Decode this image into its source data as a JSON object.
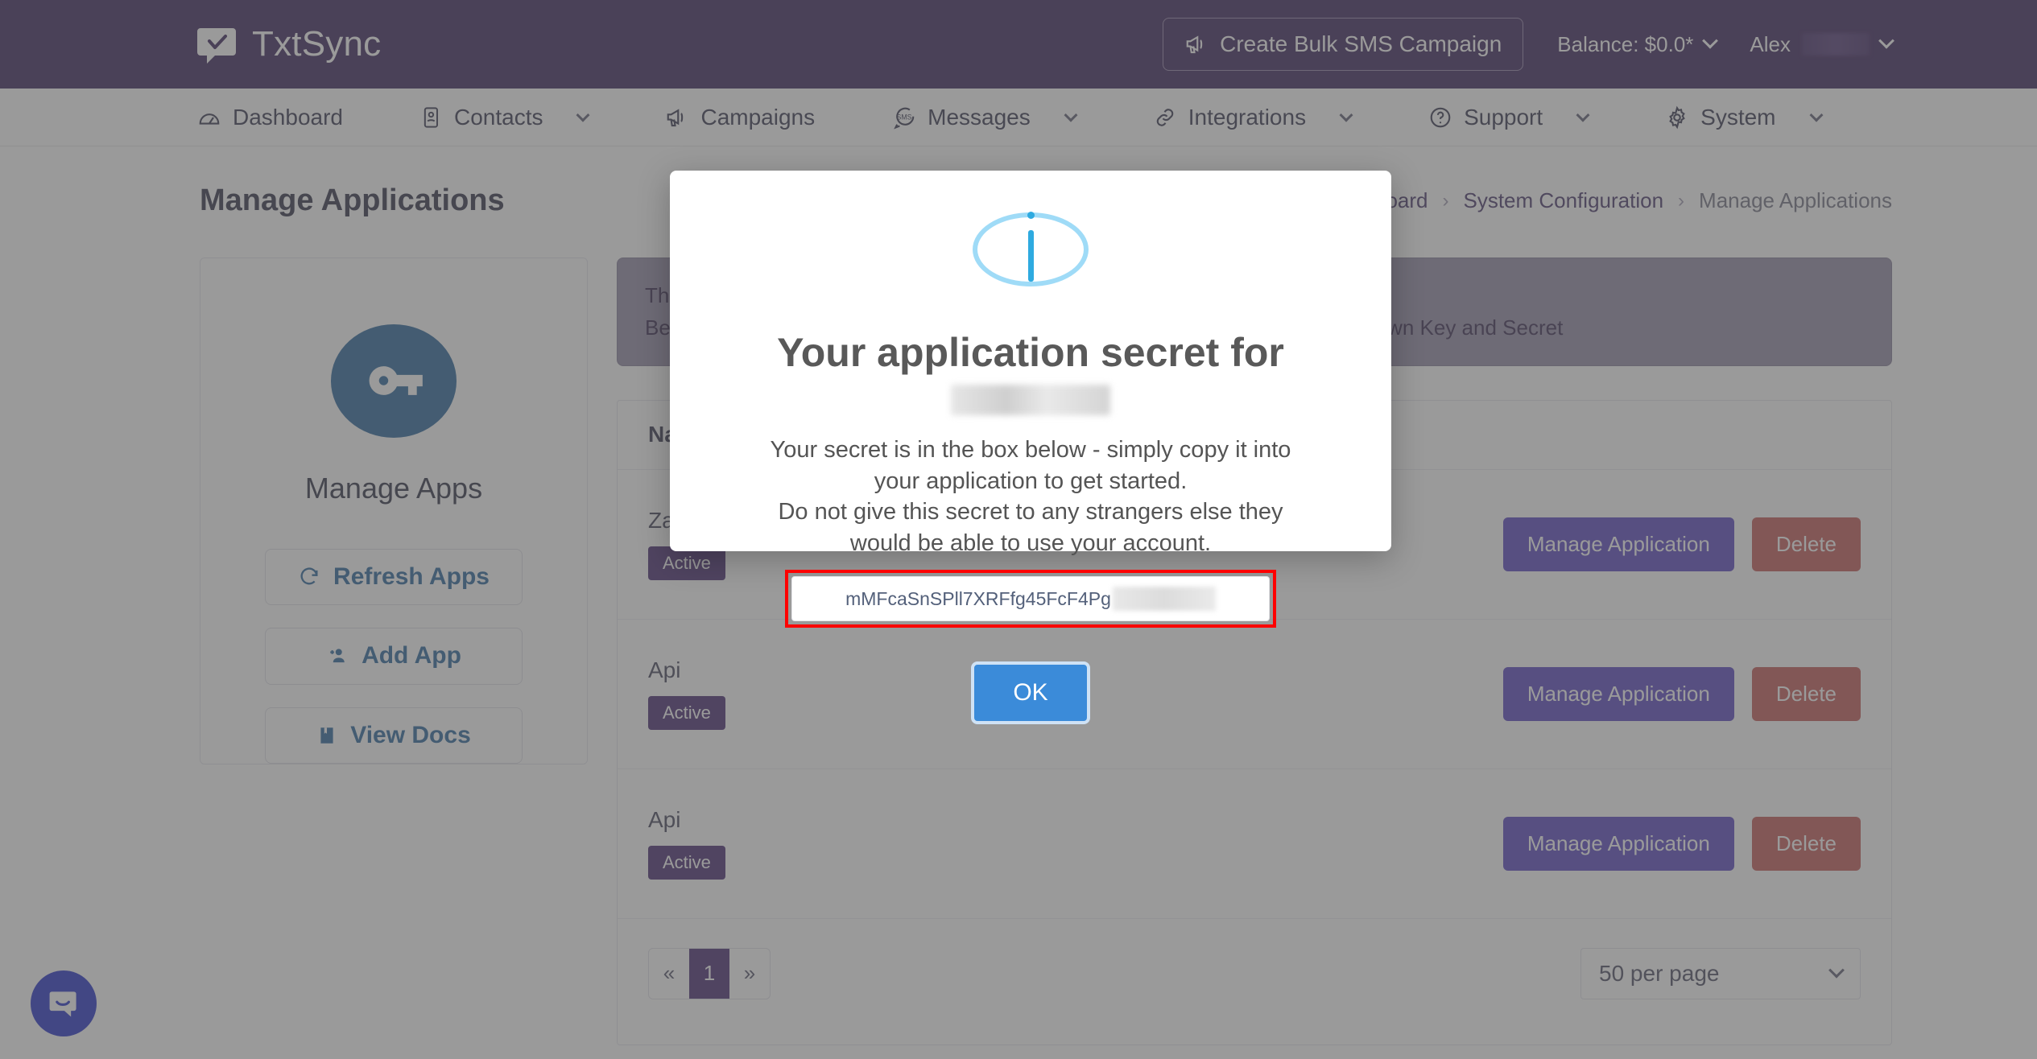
{
  "header": {
    "brand": "TxtSync",
    "bulk_campaign_label": "Create Bulk SMS Campaign",
    "balance_label": "Balance: $0.0*",
    "user_label": "Alex",
    "brand_color": "#2f1551"
  },
  "nav": {
    "items": [
      {
        "label": "Dashboard",
        "icon": "gauge-icon",
        "caret": false
      },
      {
        "label": "Contacts",
        "icon": "contact-card-icon",
        "caret": true
      },
      {
        "label": "Campaigns",
        "icon": "megaphone-icon",
        "caret": false
      },
      {
        "label": "Messages",
        "icon": "sms-bubble-icon",
        "caret": true
      },
      {
        "label": "Integrations",
        "icon": "link-icon",
        "caret": true
      },
      {
        "label": "Support",
        "icon": "question-circle-icon",
        "caret": true
      },
      {
        "label": "System",
        "icon": "gear-icon",
        "caret": true
      }
    ]
  },
  "page": {
    "title": "Manage Applications",
    "breadcrumb": [
      "Dashboard",
      "System Configuration",
      "Manage Applications"
    ]
  },
  "sidebar": {
    "card_title": "Manage Apps",
    "icon": "key-icon",
    "buttons": [
      {
        "label": "Refresh Apps",
        "icon": "refresh-icon"
      },
      {
        "label": "Add App",
        "icon": "person-add-icon"
      },
      {
        "label": "View Docs",
        "icon": "book-icon"
      }
    ]
  },
  "banner": {
    "line1": "The TxtSync API documentation can be found at docs.txtsync.com.",
    "line2": "Before you start, create an application below and we will provide you with your own Key and Secret"
  },
  "table": {
    "columns": [
      "Name"
    ],
    "rows": [
      {
        "name": "Zapier",
        "status": "Active",
        "manage_label": "Manage Application",
        "delete_label": "Delete"
      },
      {
        "name": "Api",
        "status": "Active",
        "manage_label": "Manage Application",
        "delete_label": "Delete"
      },
      {
        "name": "Api",
        "status": "Active",
        "manage_label": "Manage Application",
        "delete_label": "Delete"
      }
    ],
    "pagination": {
      "prev": "«",
      "page": "1",
      "next": "»"
    },
    "per_page": "50 per page"
  },
  "modal": {
    "icon": "info-icon",
    "title": "Your application secret for",
    "app_name_redacted": "",
    "body_line1": "Your secret is in the box below - simply copy it into",
    "body_line2": "your application to get started.",
    "body_line3": "Do not give this secret to any strangers else they",
    "body_line4": "would be able to use your account.",
    "secret": "mMFcaSnSPll7XRFfg45FcF4Pg",
    "ok_label": "OK",
    "highlight_color": "#ff0000",
    "ok_color": "#3b8bd9"
  },
  "chat": {
    "icon": "intercom-chat-icon",
    "color": "#1a25c4"
  }
}
